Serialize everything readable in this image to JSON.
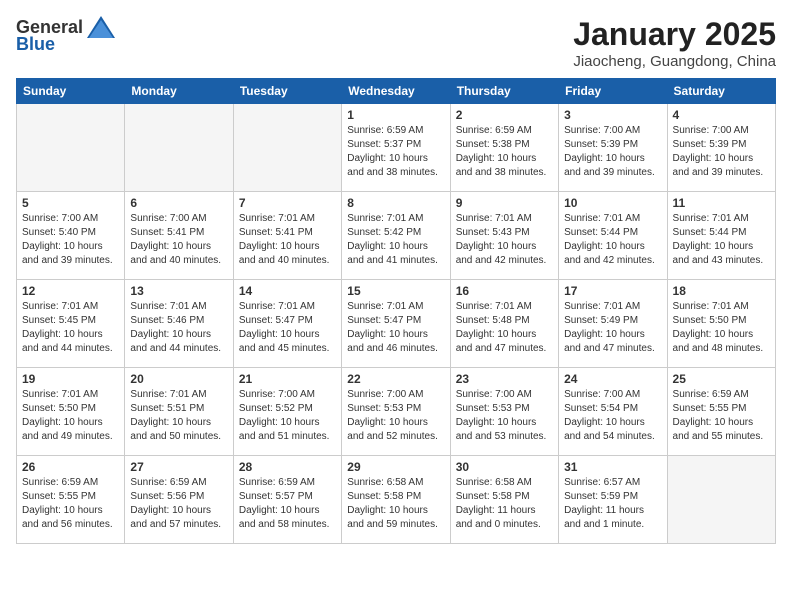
{
  "logo": {
    "general": "General",
    "blue": "Blue"
  },
  "title": "January 2025",
  "subtitle": "Jiaocheng, Guangdong, China",
  "days_of_week": [
    "Sunday",
    "Monday",
    "Tuesday",
    "Wednesday",
    "Thursday",
    "Friday",
    "Saturday"
  ],
  "weeks": [
    [
      {
        "day": "",
        "sunrise": "",
        "sunset": "",
        "daylight": "",
        "empty": true
      },
      {
        "day": "",
        "sunrise": "",
        "sunset": "",
        "daylight": "",
        "empty": true
      },
      {
        "day": "",
        "sunrise": "",
        "sunset": "",
        "daylight": "",
        "empty": true
      },
      {
        "day": "1",
        "sunrise": "Sunrise: 6:59 AM",
        "sunset": "Sunset: 5:37 PM",
        "daylight": "Daylight: 10 hours and 38 minutes."
      },
      {
        "day": "2",
        "sunrise": "Sunrise: 6:59 AM",
        "sunset": "Sunset: 5:38 PM",
        "daylight": "Daylight: 10 hours and 38 minutes."
      },
      {
        "day": "3",
        "sunrise": "Sunrise: 7:00 AM",
        "sunset": "Sunset: 5:39 PM",
        "daylight": "Daylight: 10 hours and 39 minutes."
      },
      {
        "day": "4",
        "sunrise": "Sunrise: 7:00 AM",
        "sunset": "Sunset: 5:39 PM",
        "daylight": "Daylight: 10 hours and 39 minutes."
      }
    ],
    [
      {
        "day": "5",
        "sunrise": "Sunrise: 7:00 AM",
        "sunset": "Sunset: 5:40 PM",
        "daylight": "Daylight: 10 hours and 39 minutes."
      },
      {
        "day": "6",
        "sunrise": "Sunrise: 7:00 AM",
        "sunset": "Sunset: 5:41 PM",
        "daylight": "Daylight: 10 hours and 40 minutes."
      },
      {
        "day": "7",
        "sunrise": "Sunrise: 7:01 AM",
        "sunset": "Sunset: 5:41 PM",
        "daylight": "Daylight: 10 hours and 40 minutes."
      },
      {
        "day": "8",
        "sunrise": "Sunrise: 7:01 AM",
        "sunset": "Sunset: 5:42 PM",
        "daylight": "Daylight: 10 hours and 41 minutes."
      },
      {
        "day": "9",
        "sunrise": "Sunrise: 7:01 AM",
        "sunset": "Sunset: 5:43 PM",
        "daylight": "Daylight: 10 hours and 42 minutes."
      },
      {
        "day": "10",
        "sunrise": "Sunrise: 7:01 AM",
        "sunset": "Sunset: 5:44 PM",
        "daylight": "Daylight: 10 hours and 42 minutes."
      },
      {
        "day": "11",
        "sunrise": "Sunrise: 7:01 AM",
        "sunset": "Sunset: 5:44 PM",
        "daylight": "Daylight: 10 hours and 43 minutes."
      }
    ],
    [
      {
        "day": "12",
        "sunrise": "Sunrise: 7:01 AM",
        "sunset": "Sunset: 5:45 PM",
        "daylight": "Daylight: 10 hours and 44 minutes."
      },
      {
        "day": "13",
        "sunrise": "Sunrise: 7:01 AM",
        "sunset": "Sunset: 5:46 PM",
        "daylight": "Daylight: 10 hours and 44 minutes."
      },
      {
        "day": "14",
        "sunrise": "Sunrise: 7:01 AM",
        "sunset": "Sunset: 5:47 PM",
        "daylight": "Daylight: 10 hours and 45 minutes."
      },
      {
        "day": "15",
        "sunrise": "Sunrise: 7:01 AM",
        "sunset": "Sunset: 5:47 PM",
        "daylight": "Daylight: 10 hours and 46 minutes."
      },
      {
        "day": "16",
        "sunrise": "Sunrise: 7:01 AM",
        "sunset": "Sunset: 5:48 PM",
        "daylight": "Daylight: 10 hours and 47 minutes."
      },
      {
        "day": "17",
        "sunrise": "Sunrise: 7:01 AM",
        "sunset": "Sunset: 5:49 PM",
        "daylight": "Daylight: 10 hours and 47 minutes."
      },
      {
        "day": "18",
        "sunrise": "Sunrise: 7:01 AM",
        "sunset": "Sunset: 5:50 PM",
        "daylight": "Daylight: 10 hours and 48 minutes."
      }
    ],
    [
      {
        "day": "19",
        "sunrise": "Sunrise: 7:01 AM",
        "sunset": "Sunset: 5:50 PM",
        "daylight": "Daylight: 10 hours and 49 minutes."
      },
      {
        "day": "20",
        "sunrise": "Sunrise: 7:01 AM",
        "sunset": "Sunset: 5:51 PM",
        "daylight": "Daylight: 10 hours and 50 minutes."
      },
      {
        "day": "21",
        "sunrise": "Sunrise: 7:00 AM",
        "sunset": "Sunset: 5:52 PM",
        "daylight": "Daylight: 10 hours and 51 minutes."
      },
      {
        "day": "22",
        "sunrise": "Sunrise: 7:00 AM",
        "sunset": "Sunset: 5:53 PM",
        "daylight": "Daylight: 10 hours and 52 minutes."
      },
      {
        "day": "23",
        "sunrise": "Sunrise: 7:00 AM",
        "sunset": "Sunset: 5:53 PM",
        "daylight": "Daylight: 10 hours and 53 minutes."
      },
      {
        "day": "24",
        "sunrise": "Sunrise: 7:00 AM",
        "sunset": "Sunset: 5:54 PM",
        "daylight": "Daylight: 10 hours and 54 minutes."
      },
      {
        "day": "25",
        "sunrise": "Sunrise: 6:59 AM",
        "sunset": "Sunset: 5:55 PM",
        "daylight": "Daylight: 10 hours and 55 minutes."
      }
    ],
    [
      {
        "day": "26",
        "sunrise": "Sunrise: 6:59 AM",
        "sunset": "Sunset: 5:55 PM",
        "daylight": "Daylight: 10 hours and 56 minutes."
      },
      {
        "day": "27",
        "sunrise": "Sunrise: 6:59 AM",
        "sunset": "Sunset: 5:56 PM",
        "daylight": "Daylight: 10 hours and 57 minutes."
      },
      {
        "day": "28",
        "sunrise": "Sunrise: 6:59 AM",
        "sunset": "Sunset: 5:57 PM",
        "daylight": "Daylight: 10 hours and 58 minutes."
      },
      {
        "day": "29",
        "sunrise": "Sunrise: 6:58 AM",
        "sunset": "Sunset: 5:58 PM",
        "daylight": "Daylight: 10 hours and 59 minutes."
      },
      {
        "day": "30",
        "sunrise": "Sunrise: 6:58 AM",
        "sunset": "Sunset: 5:58 PM",
        "daylight": "Daylight: 11 hours and 0 minutes."
      },
      {
        "day": "31",
        "sunrise": "Sunrise: 6:57 AM",
        "sunset": "Sunset: 5:59 PM",
        "daylight": "Daylight: 11 hours and 1 minute."
      },
      {
        "day": "",
        "sunrise": "",
        "sunset": "",
        "daylight": "",
        "empty": true
      }
    ]
  ]
}
